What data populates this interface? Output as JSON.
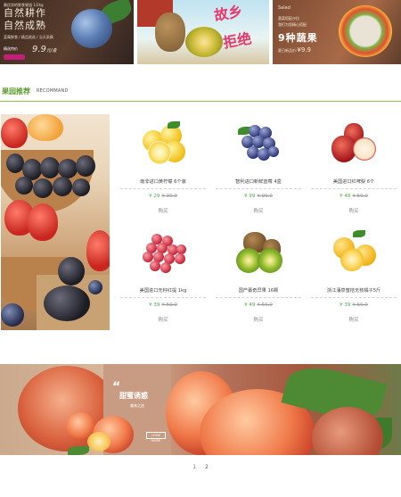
{
  "banners": [
    {
      "tiny": "最优质的鲜食果园 1/2kg",
      "line1": "自然耕作",
      "line2": "自然成熟",
      "sub": "蓝莓鲜食 / 精品挑选 / 当天采摘",
      "tag": "精选特价",
      "price": "9.9",
      "price_unit": "元/盒"
    },
    {
      "title1": "故乡",
      "title2": "拒绝"
    },
    {
      "tiny": "Salad",
      "line1": "蔬菜搭配沙拉",
      "line2": "我们为您精心搭配",
      "big": "9种蔬果",
      "price_label": "夏日新品价:",
      "price": "¥9.9"
    }
  ],
  "section": {
    "title": "果园推荐",
    "en": "RECOMMAND"
  },
  "products": [
    {
      "name": "南非进口黄柠檬 6个装",
      "price": "¥ 29",
      "old": "¥ 39.0",
      "buy": "购买"
    },
    {
      "name": "智利进口新鲜蓝莓 4盒",
      "price": "¥ 99",
      "old": "¥ 99.0",
      "buy": "购买"
    },
    {
      "name": "美国进口红啤梨 6个",
      "price": "¥ 48",
      "old": "¥ 59.0",
      "buy": "购买"
    },
    {
      "name": "美国进口无籽红提 1kg",
      "price": "¥ 39",
      "old": "¥ 59.0",
      "buy": "购买"
    },
    {
      "name": "国产綦奇异果 16颗",
      "price": "¥ 49",
      "old": "¥ 59.0",
      "buy": "购买"
    },
    {
      "name": "浙江涌泉蜜桔无核橘子5斤",
      "price": "¥ 39",
      "old": "¥ 59.0",
      "buy": "购买"
    }
  ],
  "promo": {
    "title": "甜蜜诱惑",
    "sub": "美味之选",
    "button": "LOOK MORE"
  },
  "pagination": [
    "1",
    "2"
  ],
  "colors": {
    "accent_green": "#5a9a2e",
    "price_green": "#4fa94d"
  }
}
